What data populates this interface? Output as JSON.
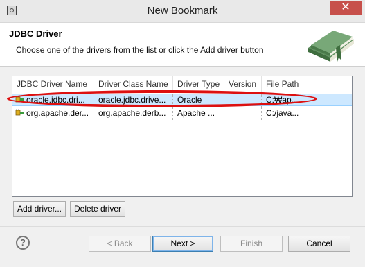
{
  "window": {
    "title": "New Bookmark",
    "close_label": "✕"
  },
  "header": {
    "title": "JDBC Driver",
    "description": "Choose one of the drivers from the list or click the Add driver button"
  },
  "table": {
    "columns": [
      "JDBC Driver Name",
      "Driver Class Name",
      "Driver Type",
      "Version",
      "File Path"
    ],
    "rows": [
      {
        "name": "oracle.jdbc.dri...",
        "class": "oracle.jdbc.drive...",
        "type": "Oracle",
        "version": "",
        "path": "C:₩ap..."
      },
      {
        "name": "org.apache.der...",
        "class": "org.apache.derb...",
        "type": "Apache ...",
        "version": "",
        "path": "C:/java..."
      }
    ]
  },
  "buttons": {
    "add_driver": "Add driver...",
    "delete_driver": "Delete driver",
    "back": "< Back",
    "next": "Next >",
    "finish": "Finish",
    "cancel": "Cancel"
  },
  "help": {
    "label": "?"
  }
}
